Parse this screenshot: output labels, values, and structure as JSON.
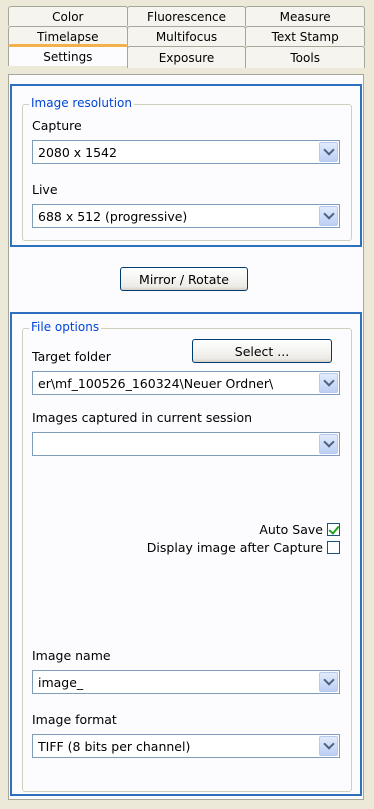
{
  "tabs": {
    "row1": [
      "Color",
      "Fluorescence",
      "Measure"
    ],
    "row2": [
      "Timelapse",
      "Multifocus",
      "Text Stamp"
    ],
    "row3": [
      "Settings",
      "Exposure",
      "Tools"
    ],
    "active": "Settings"
  },
  "image_resolution": {
    "legend": "Image resolution",
    "capture_label": "Capture",
    "capture_value": "2080 x 1542",
    "live_label": "Live",
    "live_value": "688 x 512 (progressive)"
  },
  "mirror_rotate_label": "Mirror / Rotate",
  "file_options": {
    "legend": "File options",
    "target_folder_label": "Target folder",
    "select_button_label": "Select ...",
    "target_folder_value": "er\\mf_100526_160324\\Neuer Ordner\\",
    "images_captured_label": "Images captured in current session",
    "images_captured_value": "",
    "auto_save_label": "Auto Save",
    "auto_save_checked": true,
    "display_after_capture_label": "Display image after Capture",
    "display_after_capture_checked": false,
    "image_name_label": "Image name",
    "image_name_value": "image_",
    "image_format_label": "Image format",
    "image_format_value": "TIFF (8 bits per channel)"
  },
  "colors": {
    "highlight_border": "#2f6fbf",
    "legend_text": "#0046d5",
    "active_tab_accent": "#f4b14b"
  }
}
